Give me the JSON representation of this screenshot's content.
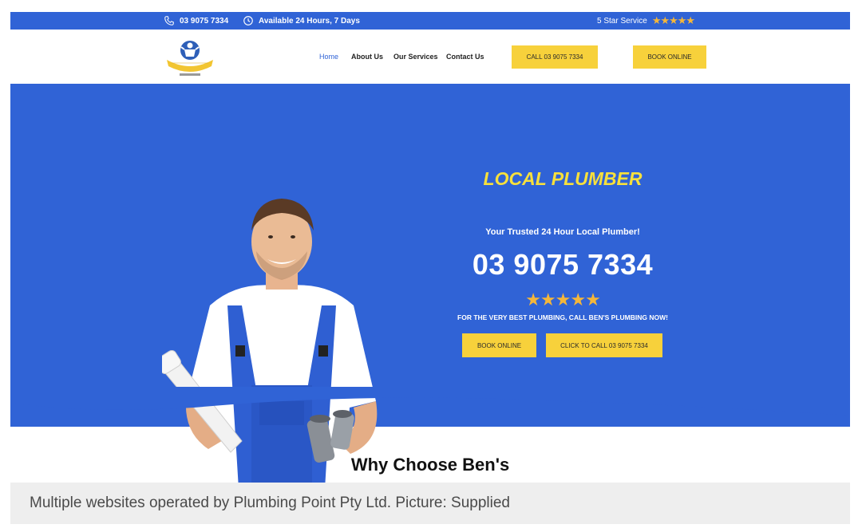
{
  "topbar": {
    "phone": "03 9075 7334",
    "hours": "Available 24 Hours, 7 Days",
    "service": "5 Star Service",
    "stars": "★★★★★"
  },
  "header": {
    "logo_icons": [
      "phone-icon",
      "clock-icon"
    ],
    "nav": {
      "home": "Home",
      "about": "About Us",
      "services": "Our Services",
      "contact": "Contact Us"
    },
    "call_button": "CALL 03 9075 7334",
    "book_button": "BOOK ONLINE"
  },
  "hero": {
    "title": "LOCAL PLUMBER",
    "subtitle": "Your Trusted 24 Hour Local Plumber!",
    "phone": "03 9075 7334",
    "stars": "★★★★★",
    "tagline": "FOR THE VERY BEST PLUMBING, CALL BEN'S PLUMBING NOW!",
    "book_button": "BOOK ONLINE",
    "call_button": "CLICK TO CALL 03 9075 7334"
  },
  "why": {
    "heading": "Why Choose Ben's"
  },
  "caption": "Multiple websites operated by Plumbing Point Pty Ltd. Picture: Supplied",
  "colors": {
    "brand_blue": "#3063d6",
    "accent_yellow": "#f7d13b",
    "title_yellow": "#f7e03c",
    "star_gold": "#f4b63a"
  }
}
